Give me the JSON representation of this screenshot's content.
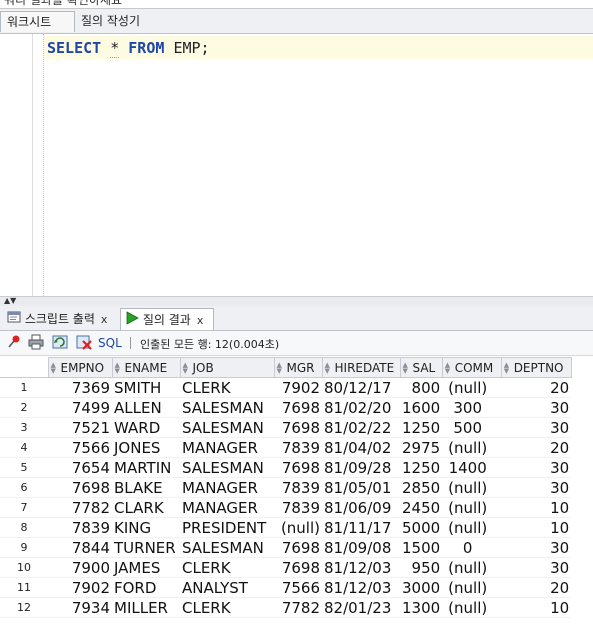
{
  "top_clip_text": "쿼리 결과를 확인하세요",
  "editor_tabs": [
    "워크시트",
    "질의 작성기"
  ],
  "sql": {
    "kw1": "SELECT",
    "star": "*",
    "kw2": "FROM",
    "table": "EMP;"
  },
  "result_tabs": [
    {
      "label": "스크립트 출력",
      "close": "x",
      "icon": "script-output-icon"
    },
    {
      "label": "질의 결과",
      "close": "x",
      "icon": "run-query-icon"
    }
  ],
  "toolbar": {
    "sql_label": "SQL",
    "status": "인출된 모든 행: 12(0.004초)"
  },
  "table": {
    "columns": [
      "EMPNO",
      "ENAME",
      "JOB",
      "MGR",
      "HIREDATE",
      "SAL",
      "COMM",
      "DEPTNO"
    ],
    "rows": [
      [
        "1",
        "7369",
        "SMITH",
        "CLERK",
        "7902",
        "80/12/17",
        "800",
        "(null)",
        "20"
      ],
      [
        "2",
        "7499",
        "ALLEN",
        "SALESMAN",
        "7698",
        "81/02/20",
        "1600",
        "300",
        "30"
      ],
      [
        "3",
        "7521",
        "WARD",
        "SALESMAN",
        "7698",
        "81/02/22",
        "1250",
        "500",
        "30"
      ],
      [
        "4",
        "7566",
        "JONES",
        "MANAGER",
        "7839",
        "81/04/02",
        "2975",
        "(null)",
        "20"
      ],
      [
        "5",
        "7654",
        "MARTIN",
        "SALESMAN",
        "7698",
        "81/09/28",
        "1250",
        "1400",
        "30"
      ],
      [
        "6",
        "7698",
        "BLAKE",
        "MANAGER",
        "7839",
        "81/05/01",
        "2850",
        "(null)",
        "30"
      ],
      [
        "7",
        "7782",
        "CLARK",
        "MANAGER",
        "7839",
        "81/06/09",
        "2450",
        "(null)",
        "10"
      ],
      [
        "8",
        "7839",
        "KING",
        "PRESIDENT",
        "(null)",
        "81/11/17",
        "5000",
        "(null)",
        "10"
      ],
      [
        "9",
        "7844",
        "TURNER",
        "SALESMAN",
        "7698",
        "81/09/08",
        "1500",
        "0",
        "30"
      ],
      [
        "10",
        "7900",
        "JAMES",
        "CLERK",
        "7698",
        "81/12/03",
        "950",
        "(null)",
        "30"
      ],
      [
        "11",
        "7902",
        "FORD",
        "ANALYST",
        "7566",
        "81/12/03",
        "3000",
        "(null)",
        "20"
      ],
      [
        "12",
        "7934",
        "MILLER",
        "CLERK",
        "7782",
        "82/01/23",
        "1300",
        "(null)",
        "10"
      ]
    ]
  },
  "colors": {
    "keyword": "#1f47a5",
    "current_line": "#fefbe3"
  }
}
